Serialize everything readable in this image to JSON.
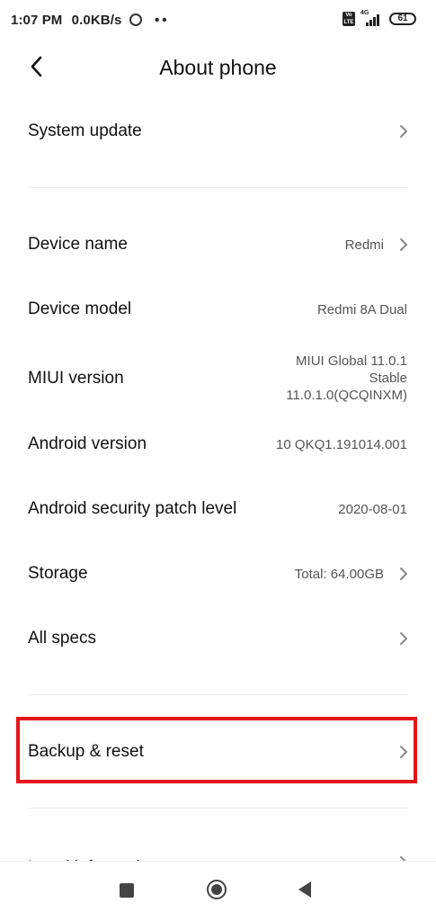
{
  "status_bar": {
    "time": "1:07 PM",
    "net_speed": "0.0KB/s",
    "dots": "••",
    "volte": "Vo LTE",
    "network_type": "4G",
    "battery": "61"
  },
  "header": {
    "title": "About phone"
  },
  "items": [
    {
      "label": "System update",
      "value": ""
    },
    {
      "label": "Device name",
      "value": "Redmi"
    },
    {
      "label": "Device model",
      "value": "Redmi 8A Dual"
    },
    {
      "label": "MIUI version",
      "value_lines": [
        "MIUI Global 11.0.1",
        "Stable",
        "11.0.1.0(QCQINXM)"
      ]
    },
    {
      "label": "Android version",
      "value": "10 QKQ1.191014.001"
    },
    {
      "label": "Android security patch level",
      "value": "2020-08-01"
    },
    {
      "label": "Storage",
      "value": "Total: 64.00GB"
    },
    {
      "label": "All specs",
      "value": ""
    },
    {
      "label": "Backup & reset",
      "value": ""
    },
    {
      "label": "Legal information",
      "value": ""
    }
  ],
  "colors": {
    "highlight": "#e3141b",
    "text": "#111111",
    "secondary": "#555555"
  }
}
